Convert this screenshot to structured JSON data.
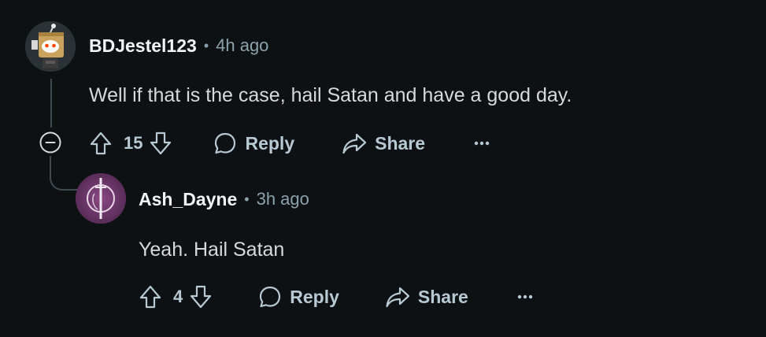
{
  "comments": [
    {
      "author": "BDJestel123",
      "separator": "•",
      "time": "4h ago",
      "body": "Well if that is the case, hail Satan and have a good day.",
      "score": "15",
      "reply_label": "Reply",
      "share_label": "Share",
      "more_label": "•••"
    },
    {
      "author": "Ash_Dayne",
      "separator": "•",
      "time": "3h ago",
      "body": "Yeah. Hail Satan",
      "score": "4",
      "reply_label": "Reply",
      "share_label": "Share",
      "more_label": "•••"
    }
  ],
  "icons": {
    "upvote": "upvote-icon",
    "downvote": "downvote-icon",
    "reply": "comment-bubble-icon",
    "share": "share-arrow-icon",
    "more": "more-dots-icon",
    "collapse": "collapse-minus-icon"
  },
  "colors": {
    "background": "#0e1113",
    "author": "#f2f4f5",
    "body": "#d7dadc",
    "secondary": "#8ba2ad",
    "action": "#b7cad4",
    "thread_line": "#3e4a50"
  }
}
